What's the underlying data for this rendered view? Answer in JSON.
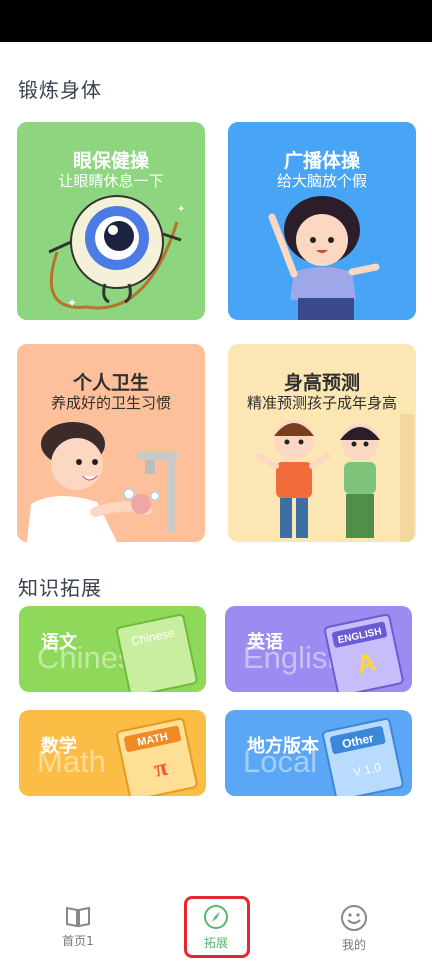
{
  "sections": {
    "exercise_title": "锻炼身体",
    "knowledge_title": "知识拓展"
  },
  "exercise_cards": [
    {
      "title": "眼保健操",
      "subtitle": "让眼睛休息一下",
      "color": "#8dd67f"
    },
    {
      "title": "广播体操",
      "subtitle": "给大脑放个假",
      "color": "#48a5f5"
    },
    {
      "title": "个人卫生",
      "subtitle": "养成好的卫生习惯",
      "color": "#fdc09b"
    },
    {
      "title": "身高预测",
      "subtitle": "精准预测孩子成年身高",
      "color": "#fbe6b4"
    }
  ],
  "knowledge_cards": [
    {
      "label": "语文",
      "bg_word": "Chinese",
      "book_label": "Chinese",
      "color": "#8ed95a"
    },
    {
      "label": "英语",
      "bg_word": "English",
      "book_label": "ENGLISH",
      "color": "#9b8cf1"
    },
    {
      "label": "数学",
      "bg_word": "Math",
      "book_label": "MATH",
      "color": "#fbbd45"
    },
    {
      "label": "地方版本",
      "bg_word": "Local",
      "book_label": "Other",
      "color": "#5ba7f5"
    }
  ],
  "tabs": [
    {
      "label": "首页1",
      "icon": "book-icon",
      "active": false
    },
    {
      "label": "拓展",
      "icon": "compass-icon",
      "active": true
    },
    {
      "label": "我的",
      "icon": "smiley-icon",
      "active": false
    }
  ],
  "colors": {
    "active_tab": "#58b56d",
    "highlight_border": "#e8262d"
  }
}
